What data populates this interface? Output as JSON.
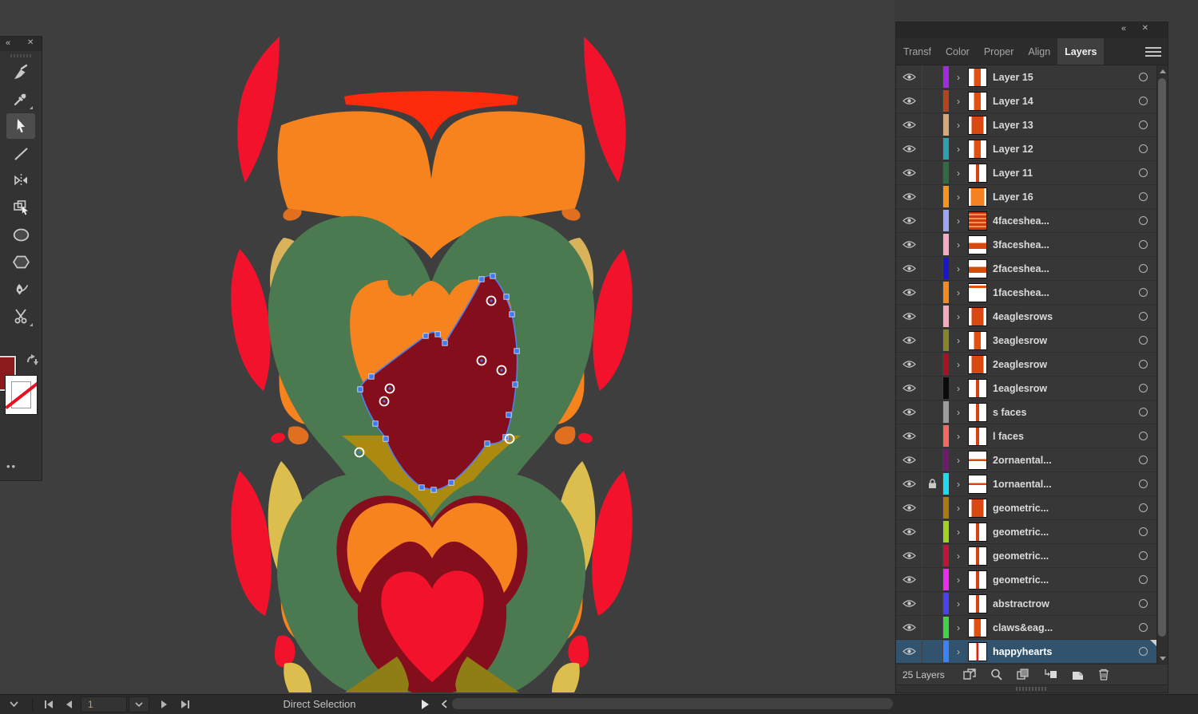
{
  "toolbar": {
    "collapse_glyph": "«",
    "close_glyph": "✕",
    "tools": [
      {
        "name": "paintbrush-tool"
      },
      {
        "name": "eyedropper-tool",
        "flyout": true
      },
      {
        "name": "selection-tool",
        "active": true
      },
      {
        "name": "line-segment-tool"
      },
      {
        "name": "reflect-tool"
      },
      {
        "name": "group-selection-tool"
      },
      {
        "name": "ellipse-tool"
      },
      {
        "name": "polygon-tool"
      },
      {
        "name": "pen-tool"
      },
      {
        "name": "scissors-tool",
        "flyout": true
      }
    ],
    "fill_color": "#8B1A1C",
    "stroke": "none",
    "more_dots": "••"
  },
  "layers_panel": {
    "collapse_glyph": "«",
    "close_glyph": "✕",
    "tabs": [
      {
        "label": "Transf"
      },
      {
        "label": "Color"
      },
      {
        "label": "Proper"
      },
      {
        "label": "Align"
      },
      {
        "label": "Layers",
        "active": true
      }
    ],
    "rows": [
      {
        "name": "Layer 15",
        "color": "#A22BE0",
        "thumb": "th-v1"
      },
      {
        "name": "Layer 14",
        "color": "#B5441C",
        "thumb": "th-v1"
      },
      {
        "name": "Layer 13",
        "color": "#D8A878",
        "thumb": "th-v2"
      },
      {
        "name": "Layer 12",
        "color": "#2D9FB0",
        "thumb": "th-v1"
      },
      {
        "name": "Layer 11",
        "color": "#2F6B44",
        "thumb": "th-v3"
      },
      {
        "name": "Layer 16",
        "color": "#F7941D",
        "thumb": "th-solid"
      },
      {
        "name": "4faceshea...",
        "color": "#9DA6F2",
        "thumb": "th-hd"
      },
      {
        "name": "3faceshea...",
        "color": "#F7A8C4",
        "thumb": "th-hband"
      },
      {
        "name": "2faceshea...",
        "color": "#1A17C9",
        "thumb": "th-hband"
      },
      {
        "name": "1faceshea...",
        "color": "#F78A1E",
        "thumb": "th-htop"
      },
      {
        "name": "4eaglesrows",
        "color": "#F7A8BC",
        "thumb": "th-v2"
      },
      {
        "name": "3eaglesrow",
        "color": "#85852C",
        "thumb": "th-v1"
      },
      {
        "name": "2eaglesrow",
        "color": "#A81324",
        "thumb": "th-v2"
      },
      {
        "name": "1eaglesrow",
        "color": "#0A0A0A",
        "thumb": "th-v3"
      },
      {
        "name": "s faces",
        "color": "#9C9C9C",
        "thumb": "th-v3"
      },
      {
        "name": "l faces",
        "color": "#F4695E",
        "thumb": "th-v3"
      },
      {
        "name": "2ornaental...",
        "color": "#701A6E",
        "thumb": "th-hline"
      },
      {
        "name": "1ornaental...",
        "color": "#20D9EF",
        "thumb": "th-hline",
        "locked": true
      },
      {
        "name": "geometric...",
        "color": "#A87A12",
        "thumb": "th-v2"
      },
      {
        "name": "geometric...",
        "color": "#9FD41F",
        "thumb": "th-v3"
      },
      {
        "name": "geometric...",
        "color": "#C01538",
        "thumb": "th-v3"
      },
      {
        "name": "geometric...",
        "color": "#EE2BEE",
        "thumb": "th-v3"
      },
      {
        "name": "abstractrow",
        "color": "#4940F0",
        "thumb": "th-v3"
      },
      {
        "name": "claws&eag...",
        "color": "#3ED34A",
        "thumb": "th-v1"
      },
      {
        "name": "happyhearts",
        "color": "#3B82F6",
        "thumb": "th-squig",
        "selected": true
      }
    ],
    "footer": {
      "count_label": "25 Layers",
      "buttons": [
        "collect-for-export",
        "locate-object",
        "make-clipping-mask",
        "new-sublayer",
        "new-layer",
        "delete-selection"
      ]
    },
    "selection_accent": "#3B82F6"
  },
  "status_bar": {
    "artboard_value": "1",
    "tool_label": "Direct Selection"
  },
  "artwork": {
    "palette": {
      "bg": "#3E3E3E",
      "orange": "#F6831E",
      "red": "#F2122B",
      "redOrange": "#FD2B0B",
      "maroon": "#850E1C",
      "green": "#4C7A50",
      "olive": "#AB8A0F",
      "oliveDark": "#8F7D15",
      "tan": "#D8B35C",
      "yellow": "#DCBE4E",
      "dotOrange": "#E0701F",
      "selectionBlue": "#4F80F2"
    }
  }
}
